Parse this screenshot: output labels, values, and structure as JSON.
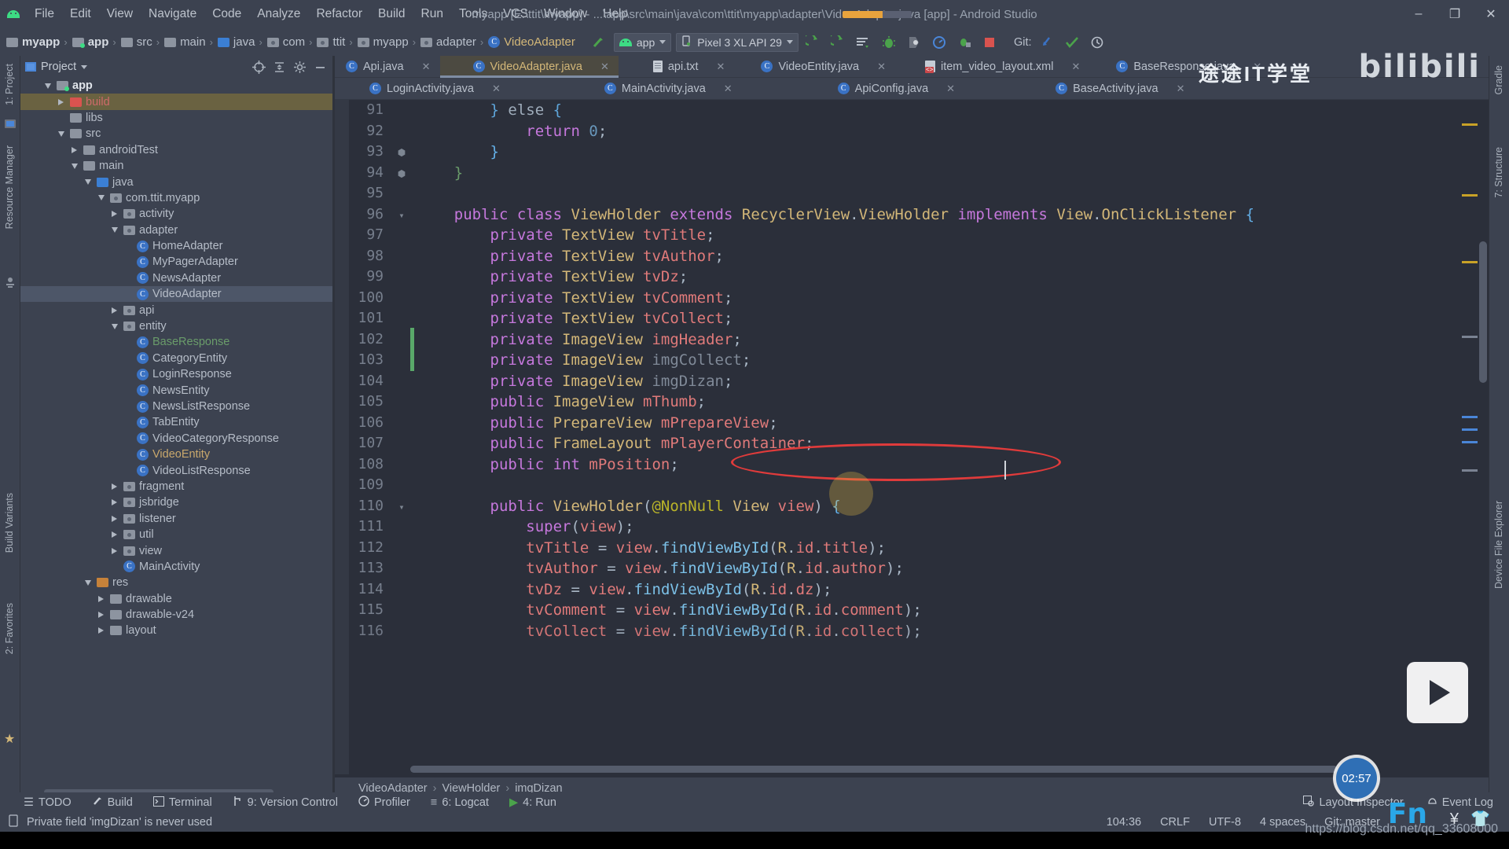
{
  "window": {
    "title": "myapp [E:\\ttit\\myapp] - ...\\app\\src\\main\\java\\com\\ttit\\myapp\\adapter\\VideoAdapter.java [app] - Android Studio",
    "minimize": "–",
    "maximize": "❐",
    "close": "✕",
    "logo_name": "android-logo"
  },
  "menubar": [
    {
      "label": "File"
    },
    {
      "label": "Edit"
    },
    {
      "label": "View"
    },
    {
      "label": "Navigate"
    },
    {
      "label": "Code"
    },
    {
      "label": "Analyze"
    },
    {
      "label": "Refactor"
    },
    {
      "label": "Build"
    },
    {
      "label": "Run"
    },
    {
      "label": "Tools"
    },
    {
      "label": "VCS"
    },
    {
      "label": "Window"
    },
    {
      "label": "Help"
    }
  ],
  "breadcrumb": [
    {
      "label": "myapp",
      "icon": "folder-icon"
    },
    {
      "label": "app",
      "icon": "module-folder-icon"
    },
    {
      "label": "src",
      "icon": "folder-icon"
    },
    {
      "label": "main",
      "icon": "folder-icon"
    },
    {
      "label": "java",
      "icon": "source-folder-icon"
    },
    {
      "label": "com",
      "icon": "package-icon"
    },
    {
      "label": "ttit",
      "icon": "package-icon"
    },
    {
      "label": "myapp",
      "icon": "package-icon"
    },
    {
      "label": "adapter",
      "icon": "package-icon"
    },
    {
      "label": "VideoAdapter",
      "icon": "java-class-icon"
    }
  ],
  "toolbar": {
    "module_selector": "app",
    "device_selector": "Pixel 3 XL API 29",
    "git_label": "Git:",
    "buttons": [
      {
        "name": "make-project-button",
        "glyph": "⮛"
      },
      {
        "name": "run-button",
        "glyph": "▶"
      },
      {
        "name": "apply-changes-button",
        "glyph": "⟳"
      },
      {
        "name": "rerun-button",
        "glyph": "⟲"
      },
      {
        "name": "edit-configurations-button",
        "glyph": "≡"
      },
      {
        "name": "debug-button",
        "glyph": "⚙"
      },
      {
        "name": "attach-debugger-button",
        "glyph": "◑"
      },
      {
        "name": "profiler-button",
        "glyph": "◴"
      },
      {
        "name": "run-with-coverage-button",
        "glyph": "⚇"
      },
      {
        "name": "stop-button",
        "glyph": "■"
      },
      {
        "name": "git-update-button",
        "glyph": "↙"
      },
      {
        "name": "git-commit-button",
        "glyph": "✓"
      },
      {
        "name": "git-history-button",
        "glyph": "⧖"
      }
    ]
  },
  "left_strip": [
    {
      "label": "1: Project",
      "name": "tool-tab-project"
    },
    {
      "label": "Resource Manager",
      "name": "tool-tab-resource-manager"
    },
    {
      "label": "Build Variants",
      "name": "tool-tab-build-variants"
    },
    {
      "label": "2: Favorites",
      "name": "tool-tab-favorites"
    }
  ],
  "right_strip": [
    {
      "label": "Gradle",
      "name": "tool-tab-gradle"
    },
    {
      "label": "7: Structure",
      "name": "tool-tab-structure"
    },
    {
      "label": "Device File Explorer",
      "name": "tool-tab-device-file-explorer"
    }
  ],
  "project_panel": {
    "title": "Project",
    "header_buttons": [
      {
        "name": "scroll-from-source-button",
        "glyph": "⊕"
      },
      {
        "name": "collapse-all-button",
        "glyph": "⤓"
      },
      {
        "name": "settings-gear-button",
        "glyph": "⚙"
      },
      {
        "name": "hide-panel-button",
        "glyph": "—"
      }
    ],
    "tree": [
      {
        "label": "app",
        "indent": 1,
        "twist": "down",
        "icon": "module-folder-icon",
        "style": "bold"
      },
      {
        "label": "build",
        "indent": 2,
        "twist": "right",
        "icon": "excluded-folder-icon",
        "style": "highlight"
      },
      {
        "label": "libs",
        "indent": 2,
        "twist": "none",
        "icon": "folder-icon"
      },
      {
        "label": "src",
        "indent": 2,
        "twist": "down",
        "icon": "folder-icon"
      },
      {
        "label": "androidTest",
        "indent": 3,
        "twist": "right",
        "icon": "folder-icon"
      },
      {
        "label": "main",
        "indent": 3,
        "twist": "down",
        "icon": "folder-icon"
      },
      {
        "label": "java",
        "indent": 4,
        "twist": "down",
        "icon": "source-folder-icon"
      },
      {
        "label": "com.ttit.myapp",
        "indent": 5,
        "twist": "down",
        "icon": "package-icon"
      },
      {
        "label": "activity",
        "indent": 6,
        "twist": "right",
        "icon": "package-icon"
      },
      {
        "label": "adapter",
        "indent": 6,
        "twist": "down",
        "icon": "package-icon"
      },
      {
        "label": "HomeAdapter",
        "indent": 7,
        "twist": "none",
        "icon": "java-class-icon"
      },
      {
        "label": "MyPagerAdapter",
        "indent": 7,
        "twist": "none",
        "icon": "java-class-icon"
      },
      {
        "label": "NewsAdapter",
        "indent": 7,
        "twist": "none",
        "icon": "java-class-icon"
      },
      {
        "label": "VideoAdapter",
        "indent": 7,
        "twist": "none",
        "icon": "java-class-icon",
        "style": "selected"
      },
      {
        "label": "api",
        "indent": 6,
        "twist": "right",
        "icon": "package-icon"
      },
      {
        "label": "entity",
        "indent": 6,
        "twist": "down",
        "icon": "package-icon"
      },
      {
        "label": "BaseResponse",
        "indent": 7,
        "twist": "none",
        "icon": "java-class-icon",
        "style": "green"
      },
      {
        "label": "CategoryEntity",
        "indent": 7,
        "twist": "none",
        "icon": "java-class-icon"
      },
      {
        "label": "LoginResponse",
        "indent": 7,
        "twist": "none",
        "icon": "java-class-icon"
      },
      {
        "label": "NewsEntity",
        "indent": 7,
        "twist": "none",
        "icon": "java-class-icon"
      },
      {
        "label": "NewsListResponse",
        "indent": 7,
        "twist": "none",
        "icon": "java-class-icon"
      },
      {
        "label": "TabEntity",
        "indent": 7,
        "twist": "none",
        "icon": "java-class-icon"
      },
      {
        "label": "VideoCategoryResponse",
        "indent": 7,
        "twist": "none",
        "icon": "java-class-icon"
      },
      {
        "label": "VideoEntity",
        "indent": 7,
        "twist": "none",
        "icon": "java-class-icon",
        "style": "amber"
      },
      {
        "label": "VideoListResponse",
        "indent": 7,
        "twist": "none",
        "icon": "java-class-icon"
      },
      {
        "label": "fragment",
        "indent": 6,
        "twist": "right",
        "icon": "package-icon"
      },
      {
        "label": "jsbridge",
        "indent": 6,
        "twist": "right",
        "icon": "package-icon"
      },
      {
        "label": "listener",
        "indent": 6,
        "twist": "right",
        "icon": "package-icon"
      },
      {
        "label": "util",
        "indent": 6,
        "twist": "right",
        "icon": "package-icon"
      },
      {
        "label": "view",
        "indent": 6,
        "twist": "right",
        "icon": "package-icon"
      },
      {
        "label": "MainActivity",
        "indent": 6,
        "twist": "none",
        "icon": "java-class-icon"
      },
      {
        "label": "res",
        "indent": 4,
        "twist": "down",
        "icon": "res-folder-icon"
      },
      {
        "label": "drawable",
        "indent": 5,
        "twist": "right",
        "icon": "folder-icon"
      },
      {
        "label": "drawable-v24",
        "indent": 5,
        "twist": "right",
        "icon": "folder-icon"
      },
      {
        "label": "layout",
        "indent": 5,
        "twist": "right",
        "icon": "folder-icon"
      }
    ]
  },
  "editor": {
    "tabs_row1": [
      {
        "label": "Api.java",
        "icon": "java-class-icon",
        "active": false
      },
      {
        "label": "VideoAdapter.java",
        "icon": "java-class-icon",
        "active": true
      },
      {
        "label": "api.txt",
        "icon": "text-file-icon",
        "active": false
      },
      {
        "label": "VideoEntity.java",
        "icon": "java-class-icon",
        "active": false
      },
      {
        "label": "item_video_layout.xml",
        "icon": "xml-file-icon",
        "active": false
      },
      {
        "label": "BaseResponse.java",
        "icon": "java-class-icon",
        "active": false
      }
    ],
    "tabs_row2": [
      {
        "label": "LoginActivity.java",
        "icon": "java-class-icon",
        "active": false
      },
      {
        "label": "MainActivity.java",
        "icon": "java-class-icon",
        "active": false
      },
      {
        "label": "ApiConfig.java",
        "icon": "java-class-icon",
        "active": false
      },
      {
        "label": "BaseActivity.java",
        "icon": "java-class-icon",
        "active": false
      }
    ],
    "close_glyph": "✕",
    "breadcrumb": [
      "VideoAdapter",
      "ViewHolder",
      "imgDizan"
    ],
    "code_lines": [
      {
        "n": 91,
        "text": "        } else {",
        "fold": "none",
        "partial": true
      },
      {
        "n": 92,
        "text": "            return 0;",
        "fold": "none"
      },
      {
        "n": 93,
        "text": "        }",
        "fold": "end"
      },
      {
        "n": 94,
        "text": "    }",
        "fold": "end"
      },
      {
        "n": 95,
        "text": "",
        "fold": "none"
      },
      {
        "n": 96,
        "text": "    public class ViewHolder extends RecyclerView.ViewHolder implements View.OnClickListener {",
        "fold": "start"
      },
      {
        "n": 97,
        "text": "        private TextView tvTitle;",
        "fold": "none"
      },
      {
        "n": 98,
        "text": "        private TextView tvAuthor;",
        "fold": "none"
      },
      {
        "n": 99,
        "text": "        private TextView tvDz;",
        "fold": "none"
      },
      {
        "n": 100,
        "text": "        private TextView tvComment;",
        "fold": "none"
      },
      {
        "n": 101,
        "text": "        private TextView tvCollect;",
        "fold": "none"
      },
      {
        "n": 102,
        "text": "        private ImageView imgHeader;",
        "fold": "none"
      },
      {
        "n": 103,
        "text": "        private ImageView imgCollect;",
        "fold": "none",
        "changed": true,
        "unused": true
      },
      {
        "n": 104,
        "text": "        private ImageView imgDizan;",
        "fold": "none",
        "changed": true,
        "unused": true
      },
      {
        "n": 105,
        "text": "        public ImageView mThumb;",
        "fold": "none"
      },
      {
        "n": 106,
        "text": "        public PrepareView mPrepareView;",
        "fold": "none"
      },
      {
        "n": 107,
        "text": "        public FrameLayout mPlayerContainer;",
        "fold": "none"
      },
      {
        "n": 108,
        "text": "        public int mPosition;",
        "fold": "none"
      },
      {
        "n": 109,
        "text": "",
        "fold": "none"
      },
      {
        "n": 110,
        "text": "        public ViewHolder(@NonNull View view) {",
        "fold": "start"
      },
      {
        "n": 111,
        "text": "            super(view);",
        "fold": "none"
      },
      {
        "n": 112,
        "text": "            tvTitle = view.findViewById(R.id.title);",
        "fold": "none"
      },
      {
        "n": 113,
        "text": "            tvAuthor = view.findViewById(R.id.author);",
        "fold": "none"
      },
      {
        "n": 114,
        "text": "            tvDz = view.findViewById(R.id.dz);",
        "fold": "none"
      },
      {
        "n": 115,
        "text": "            tvComment = view.findViewById(R.id.comment);",
        "fold": "none"
      },
      {
        "n": 116,
        "text": "            tvCollect = view.findViewById(R.id.collect);",
        "fold": "none",
        "partial": true
      }
    ]
  },
  "bottom_tool_bar": {
    "left_items": [
      {
        "label": "TODO",
        "name": "todo-tool-button",
        "glyph": "☰"
      },
      {
        "label": "Build",
        "name": "build-tool-button",
        "glyph": "⮛"
      },
      {
        "label": "Terminal",
        "name": "terminal-tool-button",
        "glyph": "⬛"
      },
      {
        "label": "9: Version Control",
        "name": "version-control-tool-button",
        "glyph": "⎇"
      },
      {
        "label": "Profiler",
        "name": "profiler-tool-button",
        "glyph": "◴"
      },
      {
        "label": "6: Logcat",
        "name": "logcat-tool-button",
        "glyph": "≡"
      },
      {
        "label": "4: Run",
        "name": "run-tool-button",
        "glyph": "▶"
      }
    ],
    "right_items": [
      {
        "label": "Layout Inspector",
        "name": "layout-inspector-button",
        "glyph": "❐"
      },
      {
        "label": "Event Log",
        "name": "event-log-button",
        "glyph": "⬡"
      }
    ]
  },
  "status_bar": {
    "message": "Private field 'imgDizan' is never used",
    "message_icon": "inspection-icon",
    "caret_position": "104:36",
    "line_separator": "CRLF",
    "encoding": "UTF-8",
    "indent": "4 spaces",
    "branch": "Git: master"
  },
  "overlays": {
    "bilibili_watermark": "bilibili",
    "chinese_watermark": "途途IT学堂",
    "timer": "02:57",
    "fn_badge": "Fn",
    "url_watermark": "https://blog.csdn.net/qq_33608000",
    "play_icon": "play-icon"
  },
  "colors": {
    "accent_amber": "#d3b778",
    "selection": "#4d5668",
    "highlight_warn": "#6a6241",
    "annotation_red": "#e03b3b",
    "change_green": "#59a869",
    "android_green": "#3ddc84"
  }
}
